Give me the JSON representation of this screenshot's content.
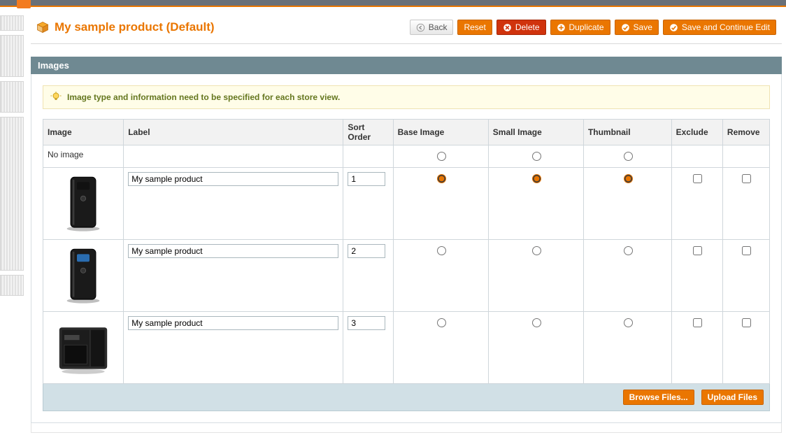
{
  "title": "My sample product (Default)",
  "buttons": {
    "back": "Back",
    "reset": "Reset",
    "delete": "Delete",
    "duplicate": "Duplicate",
    "save": "Save",
    "save_continue": "Save and Continue Edit"
  },
  "section": {
    "title": "Images"
  },
  "notice": "Image type and information need to be specified for each store view.",
  "columns": {
    "image": "Image",
    "label": "Label",
    "sort_order": "Sort Order",
    "base_image": "Base Image",
    "small_image": "Small Image",
    "thumbnail": "Thumbnail",
    "exclude": "Exclude",
    "remove": "Remove"
  },
  "rows": [
    {
      "image_placeholder": "No image",
      "label": "",
      "sort_order": "",
      "base": false,
      "small": false,
      "thumb": false,
      "exclude": false,
      "remove": false,
      "is_noimage": true
    },
    {
      "image_kind": "device-tower-a",
      "label": "My sample product",
      "sort_order": "1",
      "base": true,
      "small": true,
      "thumb": true,
      "exclude": false,
      "remove": false
    },
    {
      "image_kind": "device-tower-b",
      "label": "My sample product",
      "sort_order": "2",
      "base": false,
      "small": false,
      "thumb": false,
      "exclude": false,
      "remove": false
    },
    {
      "image_kind": "device-box",
      "label": "My sample product",
      "sort_order": "3",
      "base": false,
      "small": false,
      "thumb": false,
      "exclude": false,
      "remove": false
    }
  ],
  "footer": {
    "browse": "Browse Files...",
    "upload": "Upload Files"
  }
}
